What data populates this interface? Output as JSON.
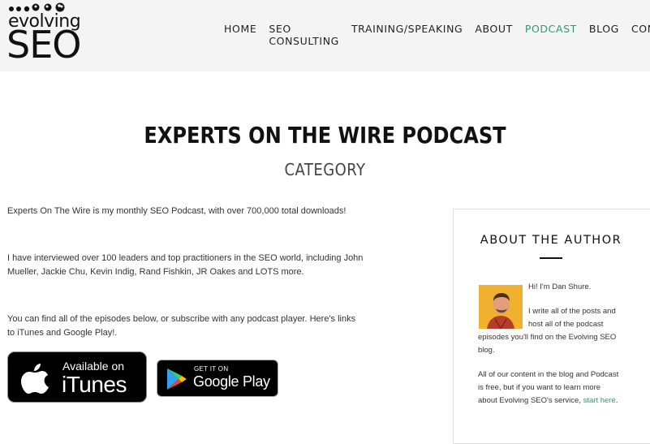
{
  "header": {
    "logo_top": "evolving",
    "logo_bottom": "SEO",
    "nav": [
      {
        "label": "HOME"
      },
      {
        "label": "SEO CONSULTING"
      },
      {
        "label": "TRAINING/SPEAKING"
      },
      {
        "label": "ABOUT"
      },
      {
        "label": "PODCAST",
        "active": true
      },
      {
        "label": "BLOG"
      },
      {
        "label": "CONTACT"
      }
    ]
  },
  "page": {
    "title": "EXPERTS ON THE WIRE PODCAST",
    "subtitle": "CATEGORY"
  },
  "content": {
    "p1": "Experts On The Wire is my monthly SEO Podcast, with over 700,000 total downloads!",
    "p2": "I have interviewed over 100 leaders and top practitioners in the SEO world, including John Mueller, Jackie Chu, Kevin Indig, Rand Fishkin, JR Oakes and LOTS more.",
    "p3": "You can find all of the episodes below, or subscribe with any podcast player. Here's links to iTunes and Google Play!.",
    "itunes_small": "Available on",
    "itunes_big": "iTunes",
    "gplay_small": "GET IT ON",
    "gplay_big": "Google Play"
  },
  "sidebar": {
    "title": "ABOUT THE AUTHOR",
    "line1": "Hi! I'm Dan Shure.",
    "line2": "I write all of the posts and",
    "line3": "host all of the podcast",
    "line4": "episodes you'll find on the Evolving SEO",
    "line5": "blog.",
    "line6": "All of our content in the blog and Podcast",
    "line7": "is free, but if you want to learn more",
    "line8_prefix": "about Evolving SEO's service, ",
    "line8_link": "start here",
    "line8_suffix": "."
  },
  "colors": {
    "accent": "#2aa06b",
    "header_bg": "#f4f4f4"
  }
}
